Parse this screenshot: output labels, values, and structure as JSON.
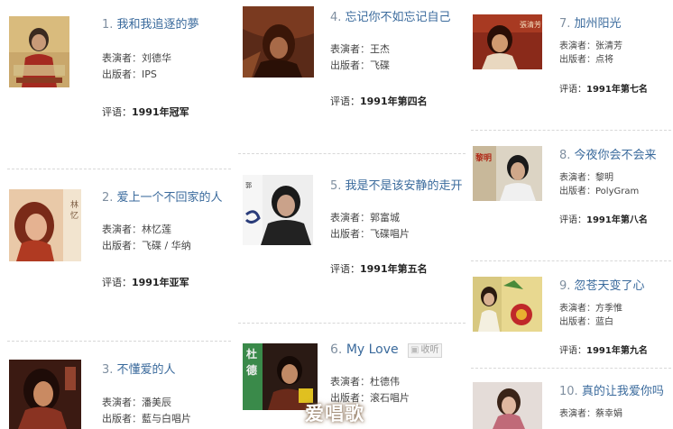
{
  "labels": {
    "performer": "表演者",
    "publisher": "出版者",
    "review": "评语",
    "separator": "：",
    "collect": "收听"
  },
  "colors": {
    "title_link": "#3a6a9c",
    "number": "#7f8fa0",
    "divider": "#d8d8d8"
  },
  "songs": [
    {
      "num": "1.",
      "title": "我和我追逐的夢",
      "performer": "刘德华",
      "publisher": "IPS",
      "review": "1991年冠军"
    },
    {
      "num": "2.",
      "title": "爱上一个不回家的人",
      "performer": "林忆莲",
      "publisher": "飞碟 / 华纳",
      "review": "1991年亚军"
    },
    {
      "num": "3.",
      "title": "不懂爱的人",
      "performer": "潘美辰",
      "publisher": "藍与白唱片",
      "review": ""
    },
    {
      "num": "4.",
      "title": "忘记你不如忘记自己",
      "performer": "王杰",
      "publisher": "飞碟",
      "review": "1991年第四名"
    },
    {
      "num": "5.",
      "title": "我是不是该安静的走开",
      "performer": "郭富城",
      "publisher": "飞碟唱片",
      "review": "1991年第五名"
    },
    {
      "num": "6.",
      "title": "My Love",
      "performer": "杜德伟",
      "publisher": "滚石唱片",
      "review": ""
    },
    {
      "num": "7.",
      "title": "加州阳光",
      "performer": "张清芳",
      "publisher": "点将",
      "review": "1991年第七名"
    },
    {
      "num": "8.",
      "title": "今夜你会不会来",
      "performer": "黎明",
      "publisher": "PolyGram",
      "review": "1991年第八名"
    },
    {
      "num": "9.",
      "title": "忽苍天变了心",
      "performer": "方季惟",
      "publisher": "蓝白",
      "review": "1991年第九名"
    },
    {
      "num": "10.",
      "title": "真的让我爱你吗",
      "performer": "蔡幸娟",
      "publisher": "",
      "review": ""
    }
  ],
  "watermark": "爱唱歌"
}
